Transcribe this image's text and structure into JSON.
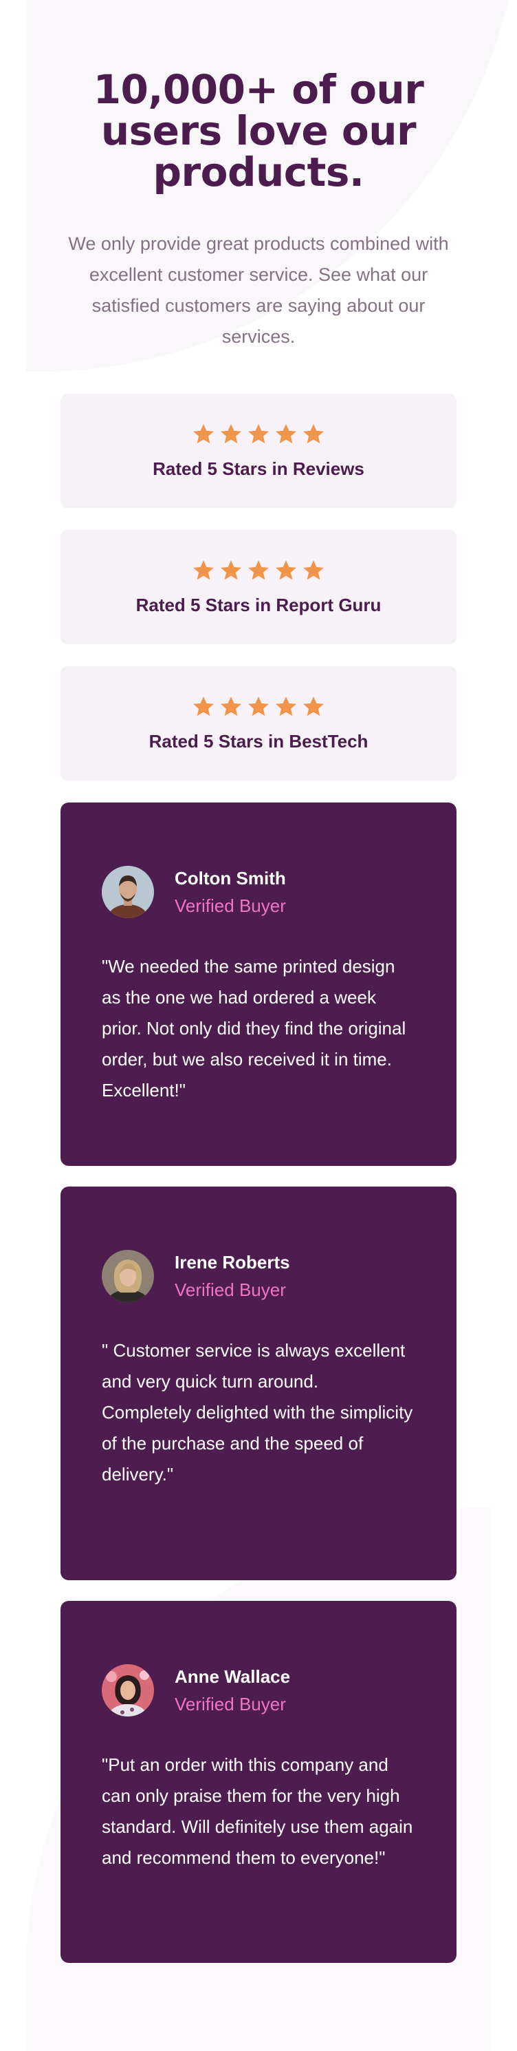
{
  "hero": {
    "title": "10,000+ of our users love our products.",
    "text": "We only provide great products combined with excellent customer service. See what our satisfied customers are saying about our services."
  },
  "ratings": [
    {
      "label": "Rated 5 Stars in Reviews",
      "stars": 5
    },
    {
      "label": "Rated 5 Stars in Report Guru",
      "stars": 5
    },
    {
      "label": "Rated 5 Stars in BestTech",
      "stars": 5
    }
  ],
  "testimonials": [
    {
      "name": "Colton Smith",
      "role": "Verified Buyer",
      "quote": "\"We needed the same printed design as the one we had ordered a week prior. Not only did they find the original order, but we also received it in time. Excellent!\""
    },
    {
      "name": "Irene Roberts",
      "role": "Verified Buyer",
      "quote": "\" Customer service is always excellent and very quick turn around.\nCompletely delighted with the simplicity of the purchase and the speed of delivery.\""
    },
    {
      "name": "Anne Wallace",
      "role": "Verified Buyer",
      "quote": "\"Put an order with this company and can only praise them for the very high standard. Will definitely use them again and recommend them to everyone!\""
    }
  ],
  "colors": {
    "primary": "#4d1c4f",
    "accent": "#ee74c4",
    "star": "#f0954a",
    "muted": "#847184",
    "card_bg": "#f7f2f7"
  },
  "icons": {
    "star": "star-icon"
  }
}
